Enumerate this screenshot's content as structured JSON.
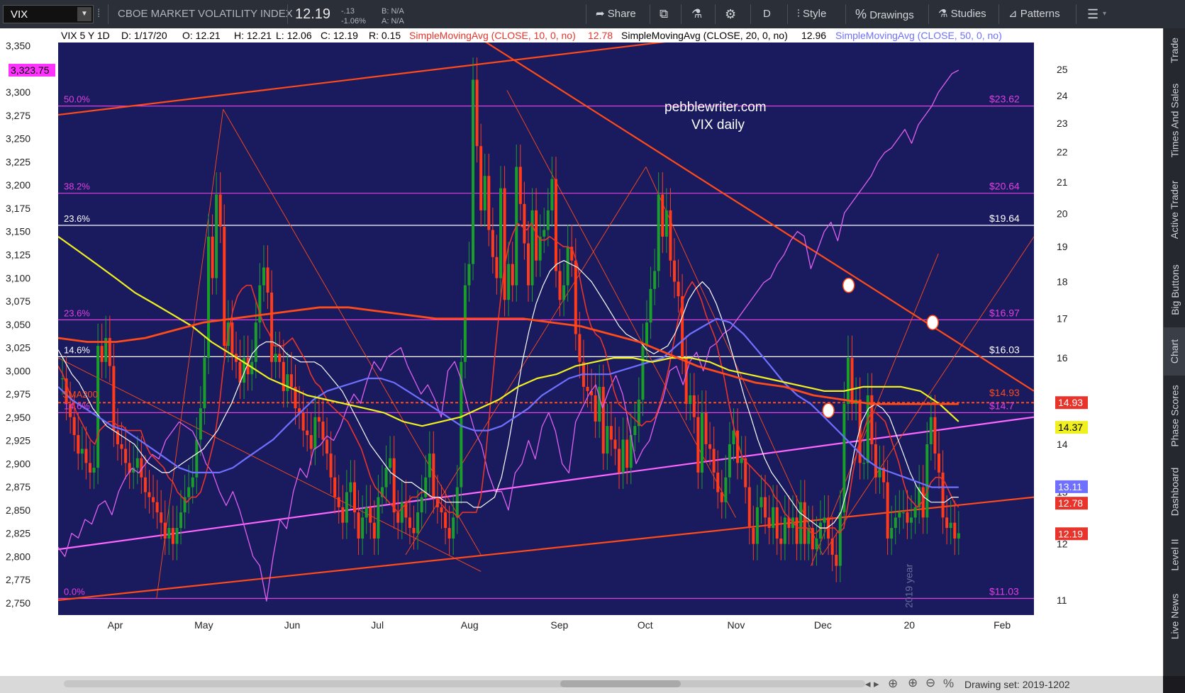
{
  "toolbar": {
    "symbol": "VIX",
    "title": "CBOE MARKET VOLATILITY INDEX",
    "last": "12.19",
    "change": "-.13",
    "change_pct": "-1.06%",
    "bid": "B: N/A",
    "ask": "A: N/A",
    "share": "Share",
    "period": "D",
    "style": "Style",
    "drawings": "Drawings",
    "studies": "Studies",
    "patterns": "Patterns"
  },
  "header": {
    "symbol_period": "VIX 5 Y 1D",
    "date": "D: 1/17/20",
    "open": "O: 12.21",
    "high": "H: 12.21",
    "low": "L: 12.06",
    "close": "C: 12.19",
    "range": "R: 0.15",
    "sma10_label": "SimpleMovingAvg (CLOSE, 10, 0, no)",
    "sma10_value": "12.78",
    "sma20_label": "SimpleMovingAvg (CLOSE, 20, 0, no)",
    "sma20_value": "12.96",
    "sma50_label": "SimpleMovingAvg (CLOSE, 50, 0, no)"
  },
  "annotations": {
    "site": "pebblewriter.com",
    "subtitle": "VIX daily",
    "sma200_tag": "SMA200",
    "year_watermark": "2019 year"
  },
  "sidebar": {
    "tabs": [
      "Trade",
      "Times And Sales",
      "Active Trader",
      "Big Buttons",
      "Chart",
      "Phase Scores",
      "Dashboard",
      "Level II",
      "Live News"
    ]
  },
  "status": {
    "drawing_set": "Drawing set: 2019-1202"
  },
  "colors": {
    "bg": "#1a1b5e",
    "candle_up": "#1a9e2a",
    "candle_down": "#ff3b1a",
    "sma10": "#e8342a",
    "sma20": "#ffffff",
    "sma50": "#6f70ff",
    "sma100": "#f0f020",
    "sma200": "#ff4a1a",
    "spx": "#e060f0",
    "fib": "#e040e0"
  },
  "chart_data": {
    "type": "candlestick",
    "symbol": "VIX",
    "xlabels": [
      "Apr",
      "May",
      "Jun",
      "Jul",
      "Aug",
      "Sep",
      "Oct",
      "Nov",
      "Dec",
      "20",
      "Feb"
    ],
    "x_range": [
      "2019-03-12",
      "2020-02-12"
    ],
    "left_axis": {
      "ticks": [
        "3,350",
        "3,300",
        "3,275",
        "3,250",
        "3,225",
        "3,200",
        "3,175",
        "3,150",
        "3,125",
        "3,100",
        "3,075",
        "3,050",
        "3,025",
        "3,000",
        "2,975",
        "2,950",
        "2,925",
        "2,900",
        "2,875",
        "2,850",
        "2,825",
        "2,800",
        "2,775",
        "2,750"
      ],
      "range": [
        2737,
        3352
      ],
      "current_label": "3,323.75"
    },
    "right_axis": {
      "ticks": [
        "25",
        "24",
        "23",
        "22",
        "21",
        "20",
        "19",
        "18",
        "17",
        "16",
        "15",
        "14",
        "13",
        "12",
        "11"
      ],
      "scale": "log",
      "range": [
        10.75,
        26.0
      ]
    },
    "fib_levels": [
      {
        "label": "50.0%",
        "price": "$23.62",
        "value": 23.62,
        "color": "#e040e0"
      },
      {
        "label": "38.2%",
        "price": "$20.64",
        "value": 20.64,
        "color": "#e040e0"
      },
      {
        "label": "23.6%",
        "price": "$19.64",
        "value": 19.64,
        "color": "#ffffff"
      },
      {
        "label": "23.6%",
        "price": "$16.97",
        "value": 16.97,
        "color": "#e040e0"
      },
      {
        "label": "14.6%",
        "price": "$16.03",
        "value": 16.03,
        "color": "#ffffff"
      },
      {
        "label": "14.6%",
        "price": "$14.7",
        "value": 14.7,
        "color": "#e040e0"
      },
      {
        "label": "0.0%",
        "price": "$11.03",
        "value": 11.03,
        "color": "#e040e0"
      }
    ],
    "sma200_line": {
      "price": "$14.93",
      "value": 14.93
    },
    "price_tags": [
      {
        "text": "14.93",
        "value": 14.93,
        "bg": "#e8342a",
        "fg": "#ffffff"
      },
      {
        "text": "14.37",
        "value": 14.37,
        "bg": "#f0f020",
        "fg": "#000000"
      },
      {
        "text": "13.11",
        "value": 13.11,
        "bg": "#6f70ff",
        "fg": "#ffffff"
      },
      {
        "text": "12.78",
        "value": 12.78,
        "bg": "#e8342a",
        "fg": "#ffffff"
      },
      {
        "text": "12.19",
        "value": 12.19,
        "bg": "#e8342a",
        "fg": "#ffffff"
      }
    ],
    "closes": [
      15.5,
      14.9,
      14.6,
      14.2,
      13.8,
      13.9,
      13.6,
      13.4,
      13.5,
      16.3,
      15.9,
      16.5,
      15.8,
      14.3,
      14.0,
      13.9,
      13.6,
      13.4,
      13.5,
      13.7,
      13.3,
      13.0,
      12.9,
      12.8,
      12.6,
      12.4,
      12.1,
      12.3,
      12.0,
      12.3,
      12.6,
      12.9,
      13.1,
      13.3,
      14.1,
      14.8,
      16.0,
      19.3,
      18.1,
      20.6,
      19.6,
      16.3,
      16.9,
      16.1,
      15.9,
      15.4,
      16.0,
      15.6,
      15.9,
      16.9,
      17.9,
      18.4,
      17.7,
      15.9,
      16.1,
      15.9,
      15.2,
      15.6,
      15.3,
      14.8,
      14.7,
      14.3,
      14.2,
      13.9,
      14.6,
      14.5,
      14.1,
      13.8,
      13.3,
      12.9,
      12.7,
      12.4,
      13.0,
      13.2,
      12.6,
      12.1,
      12.5,
      12.7,
      12.4,
      12.1,
      12.9,
      13.1,
      13.5,
      13.7,
      12.6,
      12.4,
      12.8,
      12.5,
      12.3,
      12.2,
      12.6,
      12.9,
      13.3,
      13.8,
      12.9,
      12.7,
      12.6,
      12.3,
      12.1,
      12.5,
      13.1,
      15.9,
      17.9,
      18.5,
      24.6,
      22.2,
      20.1,
      21.2,
      19.5,
      18.7,
      18.1,
      20.8,
      17.5,
      18.5,
      17.9,
      21.5,
      20.3,
      19.1,
      17.9,
      20.1,
      18.6,
      19.3,
      19.5,
      20.1,
      21.1,
      18.3,
      17.5,
      17.9,
      19.0,
      18.6,
      16.6,
      15.9,
      15.3,
      15.2,
      15.1,
      14.5,
      15.3,
      13.8,
      14.4,
      14.1,
      13.9,
      13.4,
      14.1,
      13.5,
      14.2,
      14.4,
      15.0,
      16.3,
      16.9,
      17.8,
      18.3,
      20.6,
      19.3,
      20.1,
      18.6,
      18.0,
      17.6,
      16.0,
      14.9,
      15.1,
      14.6,
      13.4,
      14.7,
      14.0,
      13.9,
      13.4,
      13.0,
      12.8,
      13.3,
      14.0,
      14.3,
      13.6,
      13.7,
      13.1,
      12.3,
      12.0,
      12.7,
      12.9,
      12.5,
      12.3,
      12.7,
      12.1,
      12.0,
      12.5,
      12.3,
      12.5,
      12.0,
      12.8,
      12.0,
      12.3,
      11.9,
      12.1,
      12.4,
      12.5,
      12.1,
      11.8,
      11.6,
      12.6,
      14.9,
      16.0,
      14.9,
      15.0,
      13.6,
      13.6,
      15.1,
      14.0,
      13.3,
      13.5,
      13.2,
      12.1,
      12.3,
      12.5,
      12.6,
      12.6,
      12.4,
      12.5,
      12.7,
      13.1,
      12.5,
      14.0,
      14.6,
      13.8,
      13.4,
      12.5,
      12.3,
      12.4,
      12.1,
      12.2
    ],
    "sma10": [
      15.8,
      15.6,
      15.3,
      15.0,
      14.7,
      14.5,
      14.3,
      14.1,
      14.0,
      14.3,
      14.4,
      14.5,
      14.5,
      14.4,
      14.4,
      14.3,
      14.3,
      14.3,
      14.3,
      14.0,
      13.8,
      13.7,
      13.6,
      13.5,
      13.3,
      13.2,
      13.0,
      12.9,
      12.8,
      12.9,
      12.9,
      13.0,
      13.3,
      13.7,
      14.1,
      14.8,
      15.8,
      16.6,
      17.2,
      17.6,
      17.8,
      17.9,
      17.9,
      17.5,
      17.1,
      16.8,
      16.6,
      16.3,
      16.3,
      16.3,
      16.4,
      16.5,
      16.3,
      16.1,
      15.9,
      15.6,
      15.4,
      15.3,
      15.1,
      14.9,
      14.8,
      14.7,
      14.6,
      14.5,
      14.3,
      14.1,
      13.9,
      13.6,
      13.3,
      13.1,
      13.0,
      12.9,
      12.8,
      12.7,
      12.6,
      12.7,
      12.8,
      12.9,
      12.9,
      13.0,
      13.0,
      12.9,
      12.9,
      12.8,
      12.7,
      12.6,
      12.6,
      12.5,
      12.6,
      12.6,
      12.6,
      12.6,
      12.9,
      13.7,
      14.8,
      16.0,
      17.2,
      18.3,
      19.0,
      19.4,
      19.7,
      19.6,
      19.5,
      19.7,
      19.4,
      19.2,
      19.2,
      19.3,
      19.2,
      19.1,
      19.0,
      19.0,
      18.9,
      18.5,
      17.8,
      17.2,
      16.8,
      16.6,
      16.5,
      16.2,
      15.7,
      15.2,
      14.9,
      14.8,
      14.7,
      14.6,
      14.5,
      14.4,
      14.5,
      14.5,
      14.6,
      14.9,
      15.3,
      15.8,
      16.4,
      17.0,
      17.5,
      17.8,
      18.0,
      17.8,
      17.5,
      17.1,
      16.8,
      16.5,
      16.0,
      15.5,
      14.9,
      14.4,
      14.0,
      13.7,
      13.6,
      13.5,
      13.4,
      13.3,
      13.2,
      13.1,
      12.9,
      12.8,
      12.6,
      12.5,
      12.4,
      12.3,
      12.3,
      12.3,
      12.2,
      12.2,
      12.3,
      12.3,
      12.3,
      12.3,
      12.2,
      12.3,
      12.8,
      13.4,
      13.9,
      14.2,
      14.5,
      14.7,
      14.7,
      14.6,
      14.5,
      14.2,
      13.9,
      13.6,
      13.2,
      12.9,
      12.8,
      12.7,
      12.8,
      13.0,
      13.2,
      13.3,
      13.3,
      13.2,
      13.0,
      12.8,
      12.7
    ],
    "sma20": [
      16.2,
      15.9,
      15.6,
      15.4,
      15.1,
      14.8,
      14.6,
      14.4,
      14.3,
      14.2,
      14.1,
      14.0,
      13.8,
      13.6,
      13.5,
      13.4,
      13.4,
      13.5,
      13.6,
      13.7,
      13.8,
      13.9,
      14.1,
      14.3,
      14.6,
      14.9,
      15.3,
      15.7,
      16.1,
      16.3,
      16.4,
      16.4,
      16.3,
      16.1,
      16.0,
      15.9,
      15.9,
      15.9,
      15.8,
      15.6,
      15.4,
      15.2,
      14.9,
      14.6,
      14.3,
      14.0,
      13.8,
      13.6,
      13.4,
      13.3,
      13.2,
      13.2,
      13.1,
      13.0,
      12.9,
      12.9,
      12.8,
      12.8,
      12.8,
      12.8,
      12.7,
      12.7,
      12.8,
      12.9,
      13.3,
      14.0,
      14.9,
      15.9,
      16.7,
      17.4,
      17.9,
      18.3,
      18.5,
      18.6,
      18.5,
      18.4,
      18.2,
      18.0,
      17.7,
      17.4,
      17.1,
      16.8,
      16.6,
      16.5,
      16.4,
      16.2,
      16.1,
      16.2,
      16.3,
      16.6,
      17.0,
      17.5,
      17.8,
      18.0,
      17.8,
      17.4,
      16.9,
      16.3,
      15.7,
      15.1,
      14.6,
      14.1,
      13.7,
      13.4,
      13.2,
      13.0,
      12.8,
      12.6,
      12.5,
      12.4,
      12.3,
      12.3,
      12.4,
      12.6,
      13.1,
      13.9,
      14.5,
      14.8,
      14.9,
      14.8,
      14.6,
      14.2,
      13.8,
      13.4,
      13.1,
      12.9,
      12.8,
      12.8,
      12.8,
      12.9,
      12.9
    ],
    "sma50": [
      15.3,
      15.0,
      14.8,
      14.6,
      14.4,
      14.3,
      14.1,
      13.9,
      13.7,
      13.5,
      13.4,
      13.4,
      13.4,
      13.5,
      13.7,
      13.9,
      14.1,
      14.4,
      14.7,
      15.0,
      15.2,
      15.3,
      15.4,
      15.5,
      15.5,
      15.4,
      15.2,
      15.0,
      14.8,
      14.6,
      14.4,
      14.3,
      14.3,
      14.4,
      14.6,
      14.8,
      15.1,
      15.3,
      15.5,
      15.6,
      15.6,
      15.6,
      15.7,
      15.8,
      15.9,
      16.0,
      16.3,
      16.6,
      16.8,
      17.0,
      16.9,
      16.6,
      16.2,
      15.8,
      15.4,
      15.1,
      14.9,
      14.6,
      14.3,
      14.0,
      13.7,
      13.5,
      13.4,
      13.3,
      13.2,
      13.1,
      13.1,
      13.1
    ],
    "sma100": [
      19.3,
      18.9,
      18.5,
      18.1,
      17.7,
      17.4,
      17.1,
      16.8,
      16.4,
      16.1,
      15.8,
      15.5,
      15.3,
      15.1,
      15.0,
      14.9,
      14.8,
      14.7,
      14.5,
      14.4,
      14.5,
      14.6,
      14.8,
      15.0,
      15.3,
      15.5,
      15.6,
      15.8,
      15.9,
      16.0,
      16.0,
      15.9,
      16.0,
      16.0,
      15.9,
      15.7,
      15.6,
      15.5,
      15.4,
      15.3,
      15.2,
      15.2,
      15.3,
      15.3,
      15.3,
      15.2,
      14.9,
      14.5
    ],
    "sma200": [
      16.5,
      16.4,
      16.4,
      16.5,
      16.7,
      16.9,
      17.0,
      17.1,
      17.2,
      17.3,
      17.3,
      17.2,
      17.1,
      17.0,
      17.0,
      17.0,
      17.0,
      16.9,
      16.8,
      16.6,
      16.4,
      16.1,
      15.8,
      15.6,
      15.4,
      15.3,
      15.1,
      15.0,
      14.9,
      14.9,
      14.9,
      14.9
    ],
    "spx": [
      2810,
      2800,
      2825,
      2820,
      2840,
      2835,
      2855,
      2860,
      2845,
      2870,
      2885,
      2895,
      2890,
      2900,
      2910,
      2905,
      2925,
      2935,
      2945,
      2940,
      2935,
      2920,
      2900,
      2890,
      2870,
      2855,
      2870,
      2850,
      2825,
      2800,
      2790,
      2752,
      2800,
      2840,
      2830,
      2870,
      2895,
      2885,
      2915,
      2920,
      2930,
      2925,
      2940,
      2960,
      2975,
      2965,
      2990,
      3010,
      3000,
      3015,
      3020,
      3025,
      3005,
      2990,
      2975,
      2985,
      2970,
      2950,
      3000,
      3010,
      2990,
      2960,
      2935,
      2920,
      2890,
      2870,
      2870,
      2850,
      2890,
      2900,
      2925,
      2905,
      2940,
      2955,
      2935,
      2900,
      2890,
      2945,
      2960,
      2975,
      2985,
      2960,
      2980,
      2995,
      2975,
      2940,
      2900,
      2915,
      2925,
      2950,
      2970,
      3000,
      3005,
      2985,
      3010,
      3020,
      3000,
      3025,
      3030,
      3040,
      3045,
      3055,
      3065,
      3075,
      3085,
      3095,
      3100,
      3115,
      3125,
      3140,
      3150,
      3145,
      3110,
      3130,
      3150,
      3160,
      3140,
      3170,
      3180,
      3190,
      3200,
      3210,
      3225,
      3235,
      3240,
      3250,
      3260,
      3245,
      3265,
      3275,
      3285,
      3300,
      3310,
      3320,
      3323.75
    ],
    "trendlines": [
      {
        "name": "Upper red channel",
        "from": [
          "2019-03-12",
          23.3
        ],
        "to": [
          "2019-11-06",
          26.5
        ]
      },
      {
        "name": "Lower red channel",
        "from": [
          "2019-03-12",
          11.0
        ],
        "to": [
          "2020-02-12",
          12.9
        ]
      },
      {
        "name": "Pink channel",
        "from": [
          "2019-03-12",
          11.9
        ],
        "to": [
          "2020-02-12",
          14.6
        ]
      },
      {
        "name": "Declining red",
        "from": [
          "2019-08-05",
          26.2
        ],
        "to": [
          "2020-02-12",
          15.2
        ]
      }
    ],
    "markers": [
      {
        "date": "2019-12-10",
        "value": 17.9
      },
      {
        "date": "2020-01-08",
        "value": 16.9
      },
      {
        "date": "2019-12-03",
        "value": 14.75
      }
    ]
  }
}
